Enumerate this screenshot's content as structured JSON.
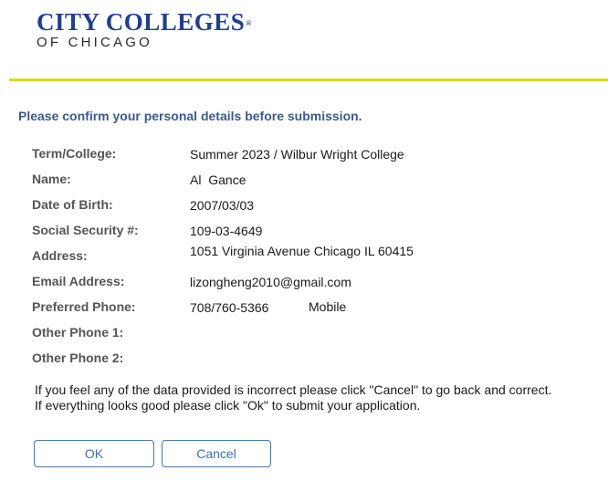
{
  "header": {
    "logo_line1": "CITY COLLEGES",
    "logo_mark": "®",
    "logo_line2": "OF CHICAGO"
  },
  "heading": "Please confirm your personal details before submission.",
  "details": [
    {
      "label": "Term/College:",
      "value": "Summer 2023 / Wilbur Wright College"
    },
    {
      "label": "Name:",
      "value": "Al  Gance"
    },
    {
      "label": "Date of Birth:",
      "value": "2007/03/03"
    },
    {
      "label": "Social Security #:",
      "value": "109-03-4649"
    },
    {
      "label": "Address:",
      "value": "1051 Virginia Avenue Chicago IL 60415"
    },
    {
      "label": "Email Address:",
      "value": "lizongheng2010@gmail.com"
    },
    {
      "label": "Preferred Phone:",
      "value": "708/760-5366",
      "type": "Mobile"
    },
    {
      "label": "Other Phone 1:",
      "value": ""
    },
    {
      "label": "Other Phone 2:",
      "value": ""
    }
  ],
  "info": {
    "line1": "If you feel any of the data provided is incorrect please click \"Cancel\" to go back and correct.",
    "line2": "If everything looks good please click \"Ok\" to submit your application."
  },
  "buttons": {
    "ok_label": "OK",
    "cancel_label": "Cancel"
  },
  "colors": {
    "brand_blue": "#1f3f8f",
    "accent_rule": "#d6dc1c",
    "heading": "#3c5a8f",
    "button_text": "#3a6fb0"
  }
}
